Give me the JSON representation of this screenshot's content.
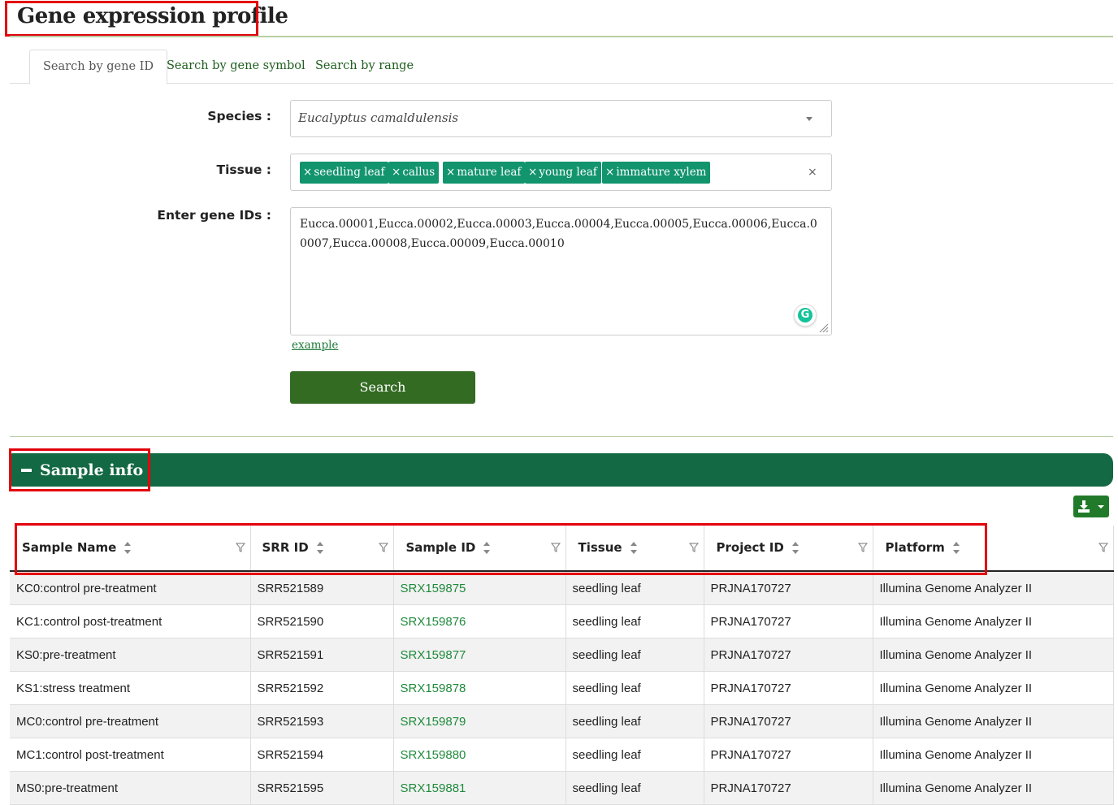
{
  "page": {
    "title": "Gene expression profile"
  },
  "tabs": [
    {
      "label": "Search by gene ID",
      "active": true
    },
    {
      "label": "Search by gene symbol",
      "active": false
    },
    {
      "label": "Search by range",
      "active": false
    }
  ],
  "form": {
    "species_label": "Species :",
    "species_value": "Eucalyptus camaldulensis",
    "tissue_label": "Tissue :",
    "tissue_chips": [
      "seedling leaf",
      "callus",
      "mature leaf",
      "young leaf",
      "immature xylem"
    ],
    "chip_remove_glyph": "×",
    "tissue_clear_glyph": "×",
    "gene_ids_label": "Enter gene IDs :",
    "gene_ids_value": "Eucca.00001,Eucca.00002,Eucca.00003,Eucca.00004,Eucca.00005,Eucca.00006,Eucca.00007,Eucca.00008,Eucca.00009,Eucca.00010",
    "example_link": "example",
    "search_button": "Search",
    "grammarly_glyph": "G"
  },
  "sample_info": {
    "title": "Sample info",
    "columns": [
      "Sample Name",
      "SRR ID",
      "Sample ID",
      "Tissue",
      "Project ID",
      "Platform"
    ],
    "rows": [
      [
        "KC0:control pre-treatment",
        "SRR521589",
        "SRX159875",
        "seedling leaf",
        "PRJNA170727",
        "Illumina Genome Analyzer II"
      ],
      [
        "KC1:control post-treatment",
        "SRR521590",
        "SRX159876",
        "seedling leaf",
        "PRJNA170727",
        "Illumina Genome Analyzer II"
      ],
      [
        "KS0:pre-treatment",
        "SRR521591",
        "SRX159877",
        "seedling leaf",
        "PRJNA170727",
        "Illumina Genome Analyzer II"
      ],
      [
        "KS1:stress treatment",
        "SRR521592",
        "SRX159878",
        "seedling leaf",
        "PRJNA170727",
        "Illumina Genome Analyzer II"
      ],
      [
        "MC0:control pre-treatment",
        "SRR521593",
        "SRX159879",
        "seedling leaf",
        "PRJNA170727",
        "Illumina Genome Analyzer II"
      ],
      [
        "MC1:control post-treatment",
        "SRR521594",
        "SRX159880",
        "seedling leaf",
        "PRJNA170727",
        "Illumina Genome Analyzer II"
      ],
      [
        "MS0:pre-treatment",
        "SRR521595",
        "SRX159881",
        "seedling leaf",
        "PRJNA170727",
        "Illumina Genome Analyzer II"
      ]
    ]
  },
  "colors": {
    "accent_green": "#136943",
    "chip_green": "#12946d",
    "button_green": "#336b23",
    "link_green": "#1f8a3c",
    "highlight_red": "#e3000b"
  }
}
